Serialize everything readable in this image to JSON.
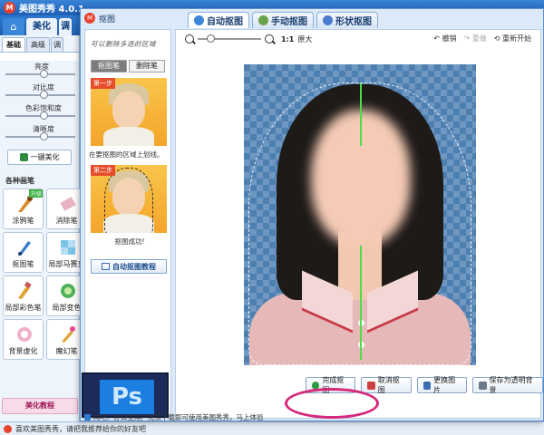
{
  "app": {
    "title": "美图秀秀 4.0.1",
    "tabs": [
      "美化",
      "调"
    ],
    "subtabs": [
      "基础",
      "高级",
      "调"
    ],
    "sliders": [
      "亮度",
      "对比度",
      "色彩饱和度",
      "清晰度"
    ],
    "one_key_label": "一键美化",
    "brush_section": "各种画笔",
    "tools": [
      {
        "label": "涂鸦笔",
        "badge": "升级",
        "icon": "brush-icon"
      },
      {
        "label": "消除笔",
        "icon": "eraser-icon"
      },
      {
        "label": "抠图笔",
        "icon": "cutout-pen-icon"
      },
      {
        "label": "局部马赛克",
        "icon": "mosaic-icon"
      },
      {
        "label": "局部彩色笔",
        "icon": "color-pen-icon"
      },
      {
        "label": "局部变色",
        "icon": "recolor-icon"
      },
      {
        "label": "背景虚化",
        "icon": "blur-icon"
      },
      {
        "label": "魔幻笔",
        "icon": "magic-pen-icon"
      }
    ],
    "bottom_button": "美化教程",
    "status": "喜欢美图秀秀，请把我推荐给你的好友吧"
  },
  "dialog": {
    "title": "抠图",
    "tabs": [
      {
        "label": "自动抠图",
        "active": true,
        "icon": "auto-cutout-icon"
      },
      {
        "label": "手动抠图",
        "active": false,
        "icon": "manual-cutout-icon"
      },
      {
        "label": "形状抠图",
        "active": false,
        "icon": "shape-cutout-icon"
      }
    ],
    "tutorial": {
      "hint": "可以删除多选的区域",
      "pen_buttons": [
        "抠图笔",
        "删除笔"
      ],
      "step1_badge": "第一步",
      "step1_caption": "在要抠图的区域上划线。",
      "step2_badge": "第二步",
      "step2_caption": "抠图成功!",
      "tutorial_button": "自动抠图教程",
      "ad_text": "Ps"
    },
    "toolbar": {
      "ratio_label": "1:1",
      "original_label": "原大",
      "undo_label": "撤销",
      "redo_label": "重做",
      "reset_label": "重新开始"
    },
    "actions": [
      {
        "label": "完成抠图",
        "icon": "check-icon",
        "color": "#2e9b3f"
      },
      {
        "label": "取消抠图",
        "icon": "cancel-icon",
        "color": "#d04040"
      },
      {
        "label": "更换图片",
        "icon": "image-icon",
        "color": "#3a6cb0"
      },
      {
        "label": "保存为透明背景",
        "icon": "save-icon",
        "color": "#6a7a8c"
      }
    ],
    "highlight_color": "#d6287a",
    "status": "网吧、办公室用户无须下载即可使用美图秀秀，马上体验"
  }
}
